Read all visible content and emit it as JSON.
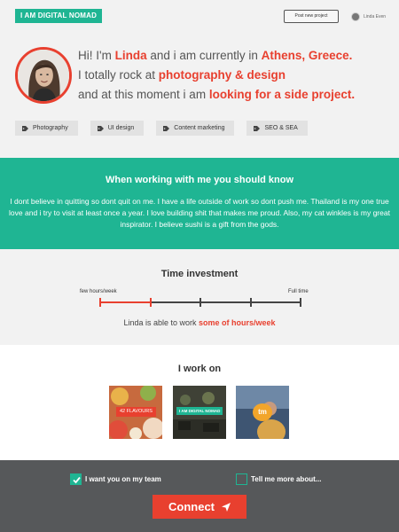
{
  "topbar": {
    "logo": "I AM DIGITAL NOMAD",
    "post_project": "Post new project",
    "user_name": "Linda Even"
  },
  "hero": {
    "line1_pre": "Hi! I'm ",
    "name": "Linda",
    "line1_mid": " and i am currently in ",
    "location": "Athens, Greece.",
    "line2_pre": "I totally rock at ",
    "skills_phrase": "photography & design",
    "line3_pre": "and at this moment i am ",
    "status": "looking for a side project."
  },
  "skills": [
    {
      "label": "Photography",
      "icon": "tag-icon"
    },
    {
      "label": "UI design",
      "icon": "tag-icon"
    },
    {
      "label": "Content marketing",
      "icon": "tag-icon"
    },
    {
      "label": "SEO & SEA",
      "icon": "tag-icon"
    }
  ],
  "about": {
    "title": "When working with me you should know",
    "text": "I dont believe in quitting so dont quit on me. I have a life outside of work so dont push me. Thailand is my one true love and i try to visit at least once a year. I love building shit that makes me proud. Also, my cat winkles is my great inspirator. I believe sushi is a gift from the gods."
  },
  "time": {
    "title": "Time investment",
    "min_label": "few hours/week",
    "max_label": "Full time",
    "level": 0.25,
    "stops": 5,
    "note_pre": "Linda is able to work ",
    "note_value": "some of hours/week"
  },
  "work": {
    "title": "I work on",
    "items": [
      {
        "label": "42 FLAVOURS"
      },
      {
        "label": "I AM DIGITAL NOMAD"
      },
      {
        "label": "tm"
      }
    ]
  },
  "footer": {
    "option1": "I want you on my team",
    "option1_checked": true,
    "option2": "Tell me more about...",
    "option2_checked": false,
    "connect": "Connect"
  },
  "colors": {
    "accent_green": "#1fb593",
    "accent_red": "#e8402f",
    "footer_bg": "#56585a"
  }
}
